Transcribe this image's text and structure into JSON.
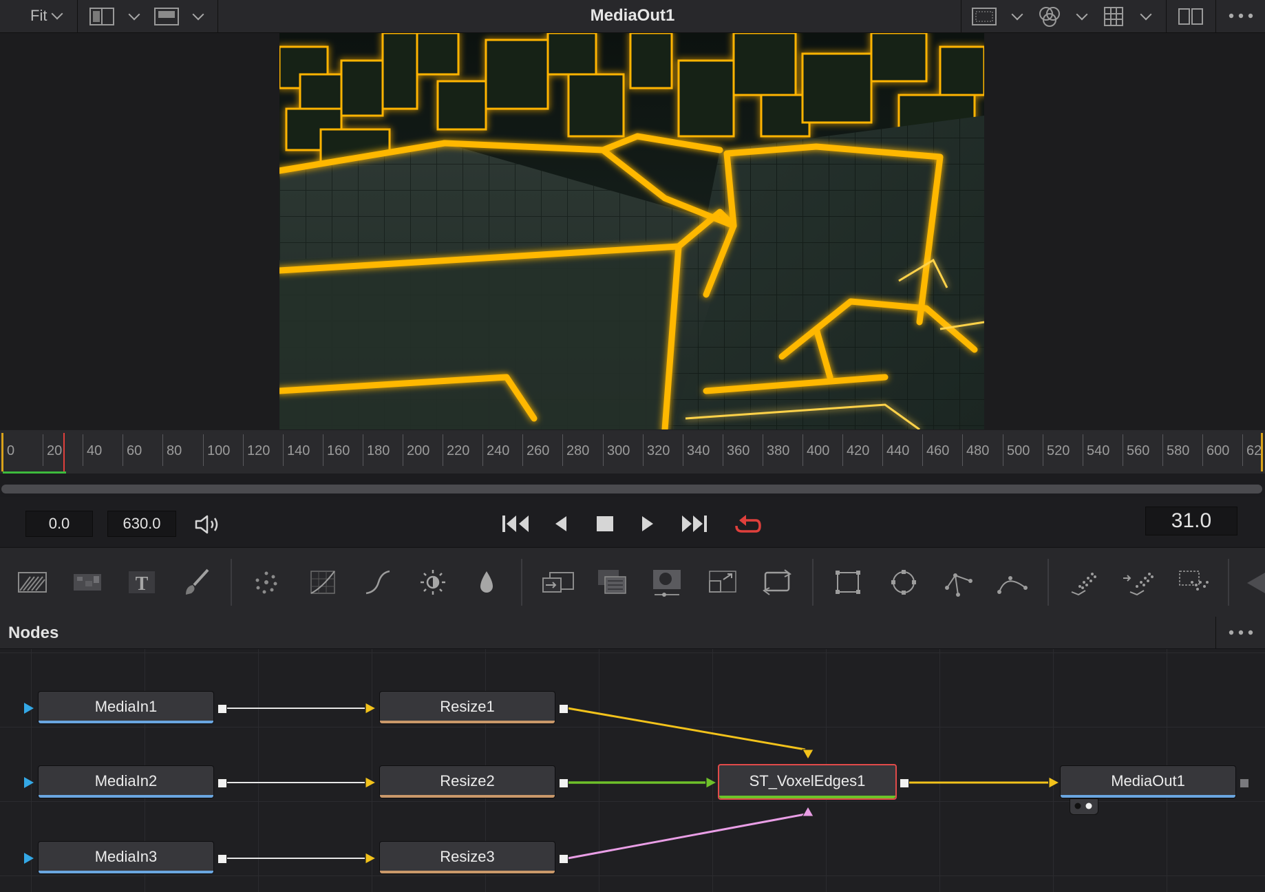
{
  "topbar": {
    "fit_label": "Fit",
    "title": "MediaOut1"
  },
  "ruler": {
    "labels": [
      "0",
      "20",
      "40",
      "60",
      "80",
      "100",
      "120",
      "140",
      "160",
      "180",
      "200",
      "220",
      "240",
      "260",
      "280",
      "300",
      "320",
      "340",
      "360",
      "380",
      "400",
      "420",
      "440",
      "460",
      "480",
      "500",
      "520",
      "540",
      "560",
      "580",
      "600",
      "62"
    ],
    "playhead_frame": 31
  },
  "transport": {
    "start": "0.0",
    "end": "630.0",
    "current": "31.0"
  },
  "nodes_panel": {
    "title": "Nodes"
  },
  "nodes": {
    "mediain1": "MediaIn1",
    "mediain2": "MediaIn2",
    "mediain3": "MediaIn3",
    "resize1": "Resize1",
    "resize2": "Resize2",
    "resize3": "Resize3",
    "voxel": "ST_VoxelEdges1",
    "mediaout": "MediaOut1"
  },
  "colors": {
    "media_in_bar": "#6aa6e0",
    "resize_bar": "#c9986a",
    "voxel_bar": "#6cc32a",
    "voxel_border": "#e24a4a",
    "link_yellow": "#f2c21b",
    "link_green": "#6fc12a",
    "link_pink": "#e99ee6",
    "loop_red": "#e0403c",
    "glow": "#ffb400"
  },
  "icons": {
    "toolbar": [
      "background-icon",
      "fastnoise-icon",
      "text-icon",
      "paint-icon",
      "particles-icon",
      "color-curves-icon",
      "brightness-contrast-icon",
      "light-icon",
      "blur-icon",
      "merge-icon",
      "channel-booleans-icon",
      "matte-control-icon",
      "resize-icon",
      "transform-icon",
      "rectangle-mask-icon",
      "ellipse-mask-icon",
      "polygon-mask-icon",
      "bspline-mask-icon",
      "particle-emitter-icon",
      "particle-render-icon",
      "image-plane-icon"
    ]
  }
}
